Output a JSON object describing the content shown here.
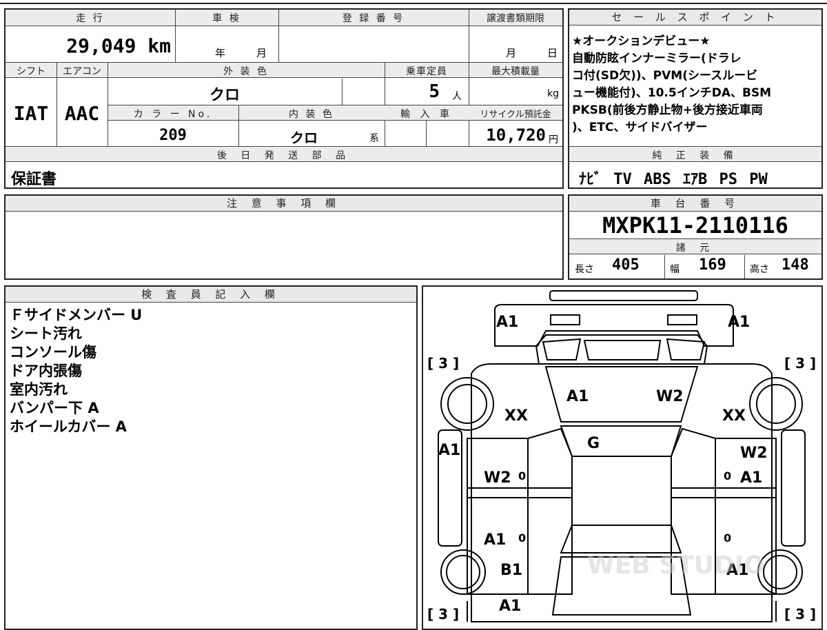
{
  "spec": {
    "mileage_label": "走 行",
    "mileage": "29,049 km",
    "shaken_label": "車 検",
    "year_label": "年",
    "month_label": "月",
    "reg_label": "登 録 番 号",
    "transfer_label": "譲渡書類期限",
    "transfer_month": "月",
    "transfer_day": "日",
    "shift_label": "シフト",
    "aircon_label": "エアコン",
    "exterior_label": "外 装 色",
    "capacity_label": "乗車定員",
    "maxload_label": "最大積載量",
    "shift": "IAT",
    "aircon": "AAC",
    "exterior": "クロ",
    "capacity": "5",
    "capacity_unit": "人",
    "load_unit": "kg",
    "color_no_label": "カ ラ ー No.",
    "interior_label": "内 装 色",
    "import_label": "輸 入 車",
    "recycle_label": "リサイクル預託金",
    "color_no": "209",
    "interior": "クロ",
    "interior_unit": "系",
    "recycle": "10,720",
    "recycle_unit": "円",
    "later_parts_label": "後 日 発 送 部 品",
    "later_parts": "保証書"
  },
  "sales": {
    "label": "セ ー ル ス ポ イ ン ト",
    "lines": [
      "★オークションデビュー★",
      "自動防眩インナーミラー(ドラレ",
      "コ付(SD欠))、PVM(シースルービ",
      "ュー機能付)、10.5インチDA、BSM",
      "PKSB(前後方静止物+後方接近車両",
      ")、ETC、サイドバイザー"
    ]
  },
  "equipment": {
    "label": "純 正 装 備",
    "items": [
      "ﾅﾋﾞ",
      "TV",
      "ABS",
      "ｴｱB",
      "PS",
      "PW"
    ]
  },
  "notes": {
    "label": "注 意 事 項 欄",
    "text": ""
  },
  "chassis": {
    "label": "車 台 番 号",
    "number": "MXPK11-2110116",
    "dims_label": "諸 元",
    "length_label": "長さ",
    "length": "405",
    "width_label": "幅",
    "width": "169",
    "height_label": "高さ",
    "height": "148"
  },
  "inspector": {
    "label": "検 査 員 記 入 欄",
    "lines": [
      "Ｆサイドメンバー U",
      "シート汚れ",
      "コンソール傷",
      "ドア内張傷",
      "室内汚れ",
      "バンパー下 A",
      "ホイールカバー A"
    ]
  },
  "diagram": {
    "marks": [
      "A1",
      "A1",
      "[ 3 ]",
      "[ 3 ]",
      "A1",
      "W2",
      "XX",
      "XX",
      "G",
      "A1",
      "W2",
      "W2",
      "0",
      "0",
      "A1",
      "A1",
      "0",
      "0",
      "B1",
      "A1",
      "A1",
      "[ 3 ]",
      "[ 3 ]"
    ],
    "watermark": "WEB STUDIO"
  }
}
